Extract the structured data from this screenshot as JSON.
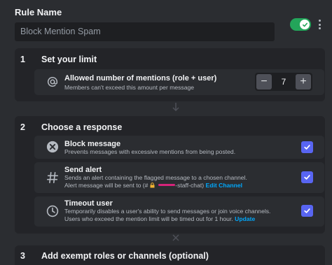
{
  "rule": {
    "label": "Rule Name",
    "value": "Block Mention Spam",
    "enabled": true
  },
  "steps": [
    {
      "number": "1",
      "title": "Set your limit"
    },
    {
      "number": "2",
      "title": "Choose a response"
    },
    {
      "number": "3",
      "title": "Add exempt roles or channels (optional)"
    }
  ],
  "limit": {
    "title": "Allowed number of mentions (role + user)",
    "description": "Members can't exceed this amount per message",
    "value": "7",
    "minus": "−",
    "plus": "+"
  },
  "responses": {
    "block": {
      "title": "Block message",
      "description": "Prevents messages with excessive mentions from being posted.",
      "checked": true
    },
    "alert": {
      "title": "Send alert",
      "description": "Sends an alert containing the flagged message to a chosen channel.",
      "destination_prefix": "Alert message will be sent to (#",
      "destination_channel": "-staff-chat)",
      "edit_label": "Edit Channel",
      "checked": true
    },
    "timeout": {
      "title": "Timeout user",
      "description": "Temporarily disables a user's ability to send messages or join voice channels.",
      "description2": "Users who exceed the mention limit will be timed out for 1 hour.",
      "update_label": "Update",
      "checked": true
    }
  },
  "colors": {
    "accent": "#5865f2",
    "toggle_on": "#23a55a",
    "link": "#00a8fc",
    "redaction": "#d6247a"
  }
}
